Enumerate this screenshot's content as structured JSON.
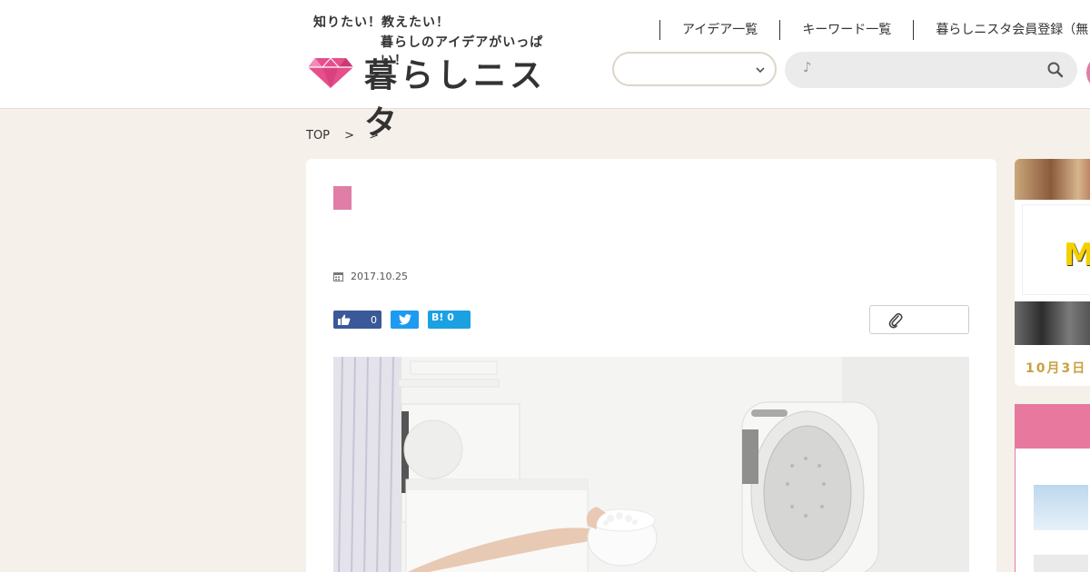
{
  "header": {
    "tagline_line1": "知りたい！教えたい！",
    "tagline_line2": "暮らしのアイデアがいっぱい！",
    "site_name": "暮らしニスタ",
    "nav": [
      "アイデア一覧",
      "キーワード一覧",
      "暮らしニスタ会員登録（無"
    ],
    "select_value": "",
    "search_placeholder": "♪"
  },
  "breadcrumb": [
    "TOP",
    ">",
    ">"
  ],
  "article": {
    "date": "2017.10.25",
    "like_count": "0",
    "hatena_count": "0",
    "hatena_label": "B!"
  },
  "sidebar": {
    "banner_letter": "M",
    "date_label": "10月3日"
  },
  "colors": {
    "accent_pink": "#e07ea7",
    "facebook": "#3b5998",
    "twitter": "#1d9bf0",
    "hatena": "#1ba1e2",
    "page_bg": "#f5f0ea"
  },
  "icons": [
    "diamond-logo-icon",
    "chevron-down-icon",
    "search-icon",
    "calendar-icon",
    "thumbs-up-icon",
    "twitter-bird-icon",
    "paperclip-icon"
  ]
}
